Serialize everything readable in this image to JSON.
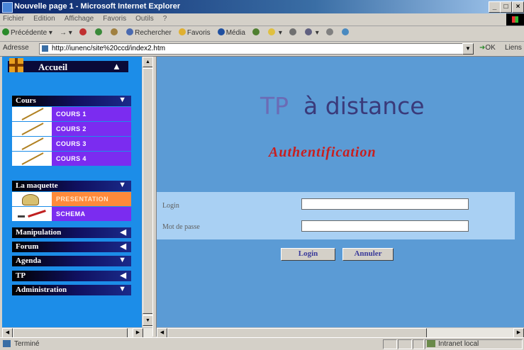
{
  "window": {
    "title": "Nouvelle page 1 - Microsoft Internet Explorer",
    "minimize": "_",
    "maximize": "□",
    "close": "×"
  },
  "menubar": [
    "Fichier",
    "Edition",
    "Affichage",
    "Favoris",
    "Outils",
    "?"
  ],
  "toolbar": {
    "back": "Précédente",
    "search": "Rechercher",
    "favorites": "Favoris",
    "media": "Média"
  },
  "address": {
    "label": "Adresse",
    "url": "http://iunenc/site%20ccd/index2.htm",
    "go": "OK",
    "links": "Liens"
  },
  "sidebar": {
    "home_label": "Accueil",
    "sections": [
      {
        "label": "Cours",
        "items": [
          "COURS 1",
          "COURS 2",
          "COURS 3",
          "COURS 4"
        ]
      },
      {
        "label": "La maquette",
        "items": [
          "PRESENTATION",
          "SCHEMA"
        ]
      },
      {
        "label": "Manipulation"
      },
      {
        "label": "Forum"
      },
      {
        "label": "Agenda"
      },
      {
        "label": "TP"
      },
      {
        "label": "Administration"
      }
    ]
  },
  "main": {
    "title_tp": "TP",
    "title_rest": "à distance",
    "subtitle": "Authentification",
    "login_label": "Login",
    "password_label": "Mot de passe",
    "login_value": "",
    "password_value": "",
    "login_button": "Login",
    "cancel_button": "Annuler"
  },
  "status": {
    "left": "Terminé",
    "zone": "Intranet local"
  },
  "colors": {
    "sidebar_bg": "#1c8de8",
    "item_purple": "#7b2cf0",
    "item_orange": "#ff8a3a",
    "content_bg": "#5b9bd5",
    "subtitle": "#c81e1e"
  }
}
